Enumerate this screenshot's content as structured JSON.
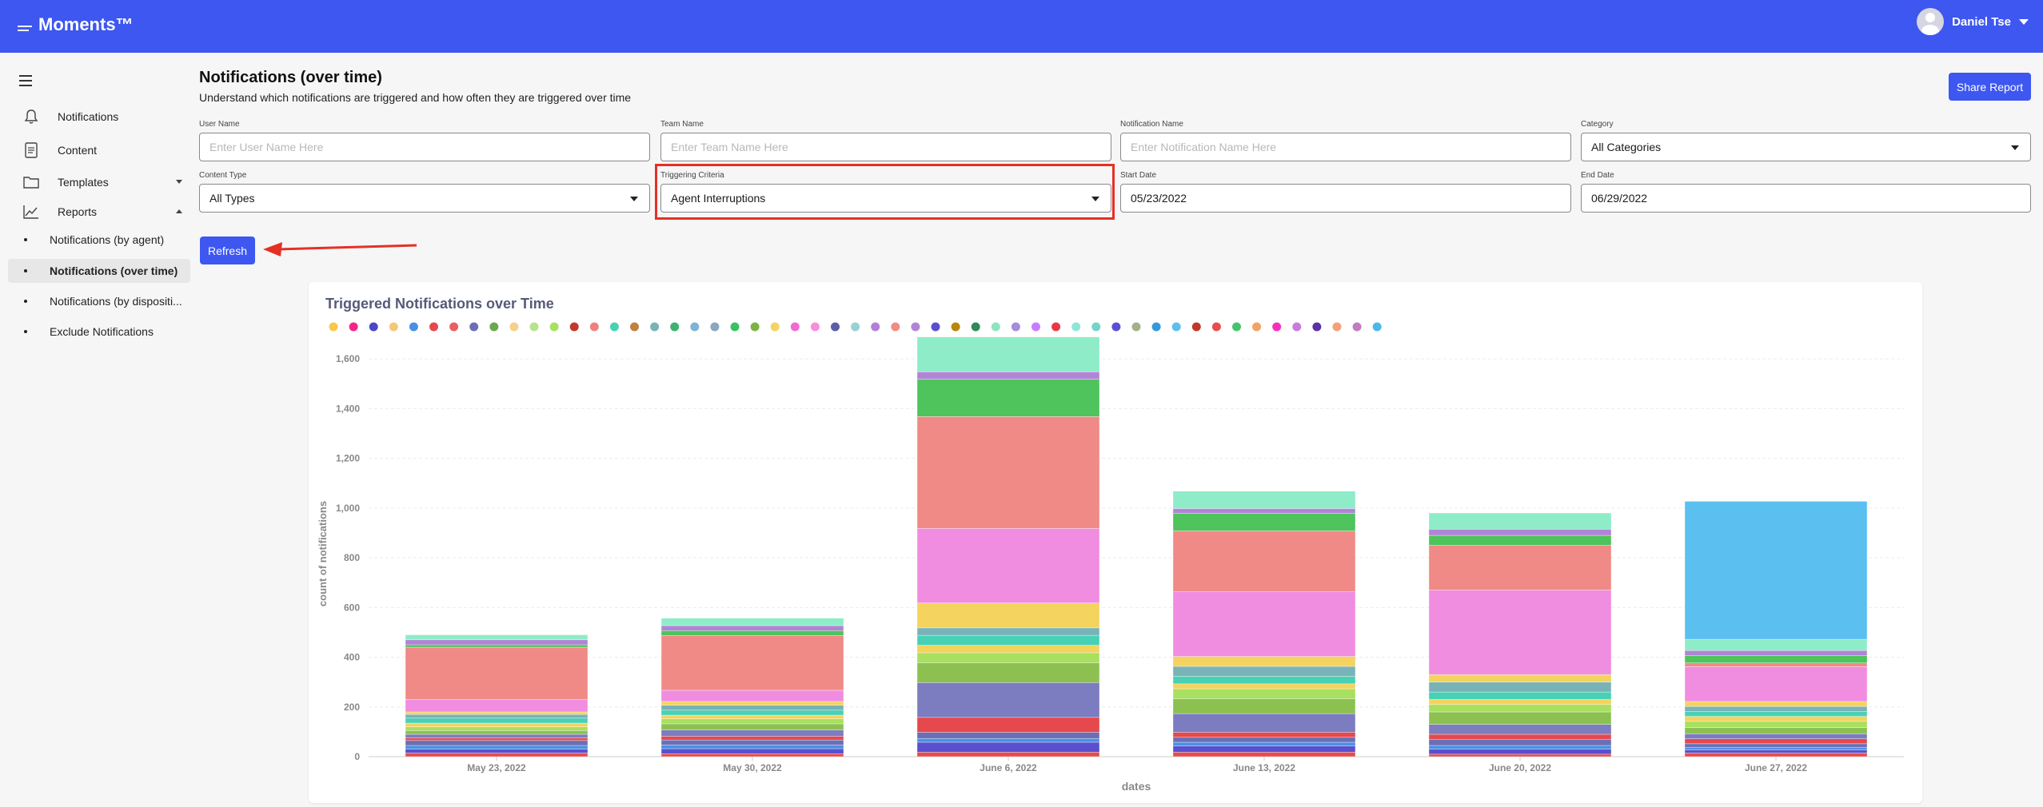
{
  "app": {
    "logo_text": "Moments™",
    "user_name": "Daniel Tse"
  },
  "sidebar": {
    "items": [
      {
        "label": "Notifications",
        "icon": "bell-icon"
      },
      {
        "label": "Content",
        "icon": "document-icon"
      },
      {
        "label": "Templates",
        "icon": "folder-icon"
      },
      {
        "label": "Reports",
        "icon": "chart-line-icon"
      }
    ],
    "report_items": [
      {
        "label": "Notifications (by agent)"
      },
      {
        "label": "Notifications (over time)"
      },
      {
        "label": "Notifications (by dispositi..."
      },
      {
        "label": "Exclude Notifications"
      }
    ]
  },
  "header": {
    "title": "Notifications (over time)",
    "subtitle": "Understand which notifications are triggered and how often they are triggered over time",
    "share_label": "Share Report"
  },
  "filters": {
    "user_name": {
      "label": "User Name",
      "placeholder": "Enter User Name Here"
    },
    "team_name": {
      "label": "Team Name",
      "placeholder": "Enter Team Name Here"
    },
    "notification_name": {
      "label": "Notification Name",
      "placeholder": "Enter Notification Name Here"
    },
    "category": {
      "label": "Category",
      "value": "All Categories"
    },
    "content_type": {
      "label": "Content Type",
      "value": "All Types"
    },
    "triggering_criteria": {
      "label": "Triggering Criteria",
      "value": "Agent Interruptions"
    },
    "start_date": {
      "label": "Start Date",
      "value": "05/23/2022"
    },
    "end_date": {
      "label": "End Date",
      "value": "06/29/2022"
    },
    "refresh_label": "Refresh"
  },
  "colors": {
    "brand": "#3d57f0",
    "highlight": "#e53026"
  },
  "chart_data": {
    "type": "bar",
    "stacked": true,
    "title": "Triggered Notifications over Time",
    "xlabel": "dates",
    "ylabel": "count of notifications",
    "ylim": [
      0,
      1700
    ],
    "yticks": [
      0,
      200,
      400,
      600,
      800,
      1000,
      1200,
      1400,
      1600
    ],
    "ytick_labels": [
      "0",
      "200",
      "400",
      "600",
      "800",
      "1,000",
      "1,200",
      "1,400",
      "1,600"
    ],
    "grid": true,
    "categories": [
      "May 23, 2022",
      "May 30, 2022",
      "June 6, 2022",
      "June 13, 2022",
      "June 20, 2022",
      "June 27, 2022"
    ],
    "legend_colors": [
      "#f9c74f",
      "#f72585",
      "#4a47c9",
      "#f4c87a",
      "#4a90e2",
      "#e5484d",
      "#ea5e5e",
      "#6c6fb5",
      "#6aa84f",
      "#f6d08a",
      "#b5e48c",
      "#a8e05f",
      "#c0392b",
      "#f08080",
      "#48d1b5",
      "#c08040",
      "#78b3b8",
      "#3cb371",
      "#7fb3d5",
      "#8aa6c1",
      "#3ac162",
      "#7cb342",
      "#f4d35e",
      "#f06bd0",
      "#f78fd8",
      "#5b5ea6",
      "#99d1d3",
      "#b57edc",
      "#f28b82",
      "#b085d6",
      "#5a4fcf",
      "#b8860b",
      "#2e8b57",
      "#8fe3c0",
      "#a78bda",
      "#c77dff",
      "#e63946",
      "#8ee6d8",
      "#74d4c8",
      "#5b4fd6",
      "#a3b18a",
      "#3498db",
      "#5bc0eb",
      "#c0392b",
      "#e84c4c",
      "#43c46b",
      "#f4a261",
      "#f72fbf",
      "#c77dde",
      "#5a32a3",
      "#f4a07a",
      "#c17cbf",
      "#4ab8e8"
    ],
    "series": [
      {
        "color": "#e84c4c",
        "values": [
          15,
          12,
          18,
          18,
          10,
          15
        ]
      },
      {
        "color": "#5a4fcf",
        "values": [
          15,
          20,
          40,
          25,
          20,
          12
        ]
      },
      {
        "color": "#4a90e2",
        "values": [
          15,
          15,
          15,
          15,
          15,
          10
        ]
      },
      {
        "color": "#6c6fb5",
        "values": [
          20,
          20,
          25,
          20,
          25,
          15
        ]
      },
      {
        "color": "#e5484d",
        "values": [
          10,
          15,
          60,
          20,
          20,
          20
        ]
      },
      {
        "color": "#7c7cc0",
        "values": [
          15,
          25,
          140,
          75,
          40,
          20
        ]
      },
      {
        "color": "#8cc152",
        "values": [
          15,
          25,
          80,
          60,
          50,
          25
        ]
      },
      {
        "color": "#a8e05f",
        "values": [
          15,
          20,
          40,
          40,
          30,
          25
        ]
      },
      {
        "color": "#f4d35e",
        "values": [
          15,
          15,
          30,
          20,
          20,
          20
        ]
      },
      {
        "color": "#48d1b5",
        "values": [
          20,
          20,
          40,
          30,
          30,
          20
        ]
      },
      {
        "color": "#78b3b8",
        "values": [
          15,
          20,
          30,
          40,
          40,
          20
        ]
      },
      {
        "color": "#f4d35e",
        "values": [
          10,
          15,
          100,
          40,
          30,
          20
        ]
      },
      {
        "color": "#f08de0",
        "values": [
          50,
          45,
          300,
          260,
          340,
          140
        ]
      },
      {
        "color": "#f08a86",
        "values": [
          210,
          220,
          450,
          245,
          180,
          15
        ]
      },
      {
        "color": "#4fc35c",
        "values": [
          10,
          20,
          150,
          70,
          40,
          30
        ]
      },
      {
        "color": "#b085d6",
        "values": [
          20,
          20,
          30,
          20,
          25,
          20
        ]
      },
      {
        "color": "#8eecc8",
        "values": [
          20,
          30,
          140,
          70,
          65,
          45
        ]
      },
      {
        "color": "#5bc0f0",
        "values": [
          0,
          0,
          0,
          0,
          0,
          555
        ]
      }
    ]
  }
}
